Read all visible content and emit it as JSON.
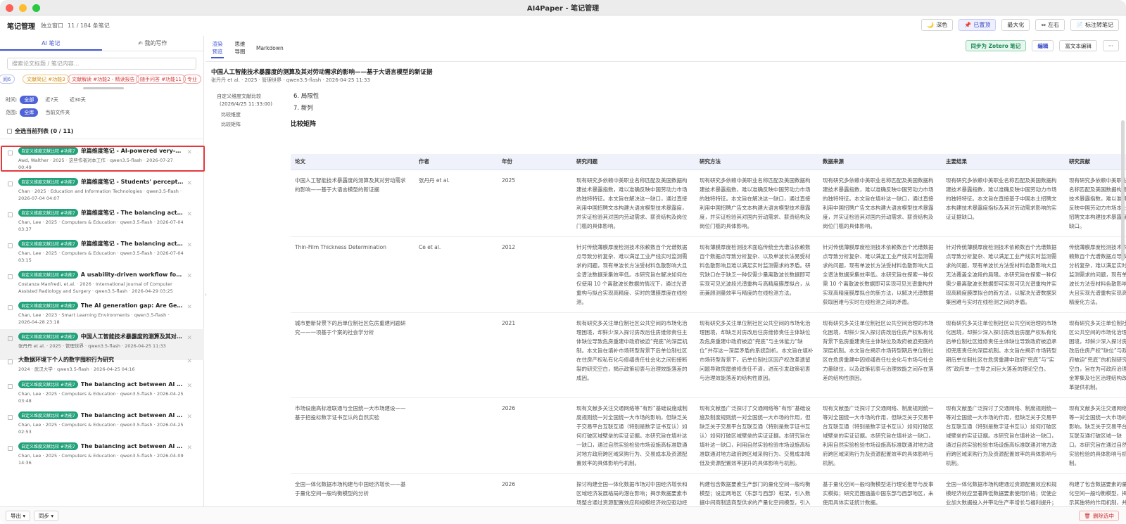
{
  "window": {
    "title": "AI4Paper - 笔记管理"
  },
  "header": {
    "title": "笔记管理",
    "subtitle": "独立窗口",
    "count": "11 / 184 条笔记",
    "buttons": {
      "dark": "深色",
      "pin": "已置顶",
      "maximize": "最大化",
      "lr": "左右",
      "annotate": "标注转笔记"
    }
  },
  "left": {
    "tabs": [
      "AI 笔记",
      "我的写作"
    ],
    "search_placeholder": "搜索论文标题 / 笔记内容...",
    "chips": [
      "阅6",
      "文献简记 #功能3",
      "文献解读 #功能2 - 精读报告",
      "随手问答 #功能11",
      "专业"
    ],
    "time_label": "时间:",
    "time_options": [
      "全部",
      "近7天",
      "近30天"
    ],
    "scope_label": "范围:",
    "scope_options": [
      "全库",
      "当前文件夹"
    ],
    "select_all": "全选当前列表 (0 / 11)",
    "items": [
      {
        "tag": "自定义维度文献比较 #功能7",
        "title": "单篇维度笔记 - AI-powered very-high-...",
        "meta": "Awd, Walther · 2025 · 这些作者对本工作 · qwen3.5-flash · 2026-07-27 00:49"
      },
      {
        "tag": "自定义维度文献比较 #功能7",
        "title": "单篇维度笔记 - Students' perceptions ...",
        "meta": "Chan · 2025 · Education and Information Technologies · qwen3.5-flash · 2026-07-04 04:07"
      },
      {
        "tag": "自定义维度文献比较 #功能7",
        "title": "单篇维度笔记 - The balancing act betw...",
        "meta": "Chan, Lee · 2025 · Computers & Education · qwen3.5-flash · 2026-07-04 03:37"
      },
      {
        "tag": "自定义维度文献比较 #功能7",
        "title": "单篇维度笔记 - The balancing act betw...",
        "meta": "Chan, Lee · 2025 · Computers & Education · qwen3.5-flash · 2026-07-04 03:15"
      },
      {
        "tag": "自定义维度文献比较 #功能7",
        "title": "A usability-driven workflow for virtual...",
        "meta": "Costanza Manfredi, et.al. · 2026 · International Journal of Computer Assisted Radiology and Surgery · qwen3.5-flash · 2026-04-29 03:25"
      },
      {
        "tag": "自定义维度文献比较 #功能7",
        "title": "The AI generation gap: Are Gen Z stu...",
        "meta": "Chan, Lee · 2023 · Smart Learning Environments · qwen3.5-flash · 2026-04-28 23:18"
      },
      {
        "tag": "自定义维度文献比较 #功能7",
        "title": "中国人工智能技术暴露度的测算及其对劳...",
        "meta": "张丹丹 et al. · 2025 · 管理世界 · qwen3.5-flash · 2026-04-25 11:33"
      },
      {
        "tag": "",
        "title": "大数据环境下个人的数字囤积行为研究",
        "meta": "2024 · 武汉大学 · qwen3.5-flash · 2026-04-25 04:16"
      },
      {
        "tag": "自定义维度文献比较 #功能7",
        "title": "The balancing act between AI and aut...",
        "meta": "Chan, Lee · 2025 · Computers & Education · qwen3.5-flash · 2026-04-25 03:48"
      },
      {
        "tag": "自定义维度文献比较 #功能7",
        "title": "The balancing act between AI and aut...",
        "meta": "Chan, Lee · 2025 · Computers & Education · qwen3.5-flash · 2026-04-25 02:53"
      },
      {
        "tag": "自定义维度文献比较 #功能7",
        "title": "The balancing act between AI and aut...",
        "meta": "Chan, Lee · 2025 · Computers & Education · qwen3.5-flash · 2026-04-09 14:36"
      }
    ]
  },
  "right": {
    "tabs": [
      "渲染预览",
      "思维导图",
      "Markdown"
    ],
    "actions": {
      "sync": "同步为 Zotero 笔记",
      "edit": "编辑",
      "rich_edit": "富文本编辑",
      "more": "···"
    },
    "note_title": "中国人工智能技术暴露度的测算及其对劳动需求的影响——基于大语言模型的新证据",
    "note_meta": "张丹丹 et al. · 2025 · 管理世界 · qwen3.5-flash · 2026-04-25 11:33",
    "toc": {
      "title": "自定义维度文献比较",
      "date": "(2026/4/25 11:33:00)",
      "items": [
        "比较维度",
        "比较矩阵"
      ]
    },
    "list": [
      "6. 局限性",
      "7. 新列"
    ],
    "section": "比较矩阵",
    "table": {
      "headers": [
        "论文",
        "作者",
        "年份",
        "研究问题",
        "研究方法",
        "数据来源",
        "主要结果",
        "研究贡献"
      ],
      "rows": [
        [
          "中国人工智能技术暴露度的测算及其对劳动需求的影响——基于大语言模型的新证据",
          "张丹丹 et al.",
          "2025",
          "现有研究多依赖中美职业名称匹配及美国数据构建技术暴露指数，难以准确反映中国劳动力市场的独特特征。本文旨在解决这一缺口，通过直接利用中国招聘文本构建大语言模型技术暴露度，并实证检验其对国内劳动需求、薪资结构及岗位门槛的具体影响。",
          "现有研究多依赖中美职业名称匹配及美国数据构建技术暴露指数，难以准确反映中国劳动力市场的独特特征。本文旨在解决这一缺口，通过直接利用中国招聘广告文本构建大语言模型技术暴露度，并实证检验其对国内劳动需求、薪资结构及岗位门槛的具体影响。",
          "现有研究多依赖中美职业名称匹配及美国数据构建技术暴露指数，难以准确反映中国劳动力市场的独特特征。本文旨在填补这一缺口，通过直接利用中国招聘广告文本构建大语言模型技术暴露度，并实证检验其对国内劳动需求、薪资结构及岗位门槛的具体影响。",
          "现有研究多依赖中美职业名称匹配及美国数据构建技术暴露指数，难以准确反映中国劳动力市场的独特特征。本文旨在直接基于中国本土招聘文本构建技术暴露度指标及其对劳动需求影响的实证证据缺口。",
          "现有研究多依赖中美职业名称匹配及美国数据构建技术暴露指数，难以准确反映中国劳动力市场本土招聘文本构建技术暴露度缺口。"
        ],
        [
          "Thin-Film Thickness Determination",
          "Ce et al.",
          "2012",
          "针对传统薄膜厚度检测技术依赖数百个光谱数据点导致分析复杂、难以满足工业产线实时监测需求的问题，现有单波长方法受材料色散影响大且全谱法数据采集效率低。本研究旨在解决如何在仅使用 10 个离散波长数据的情况下，通过光谱重构与拟合实现高精度、实时的薄膜厚度在线检测。",
          "现有薄膜厚度检测技术面临传统全光谱法依赖数百个数据点导致分析复杂、以及单波长法易受材料色散影响且难以满足实时监测需求的矛盾。研究缺口在于缺乏一种仅需少量离散波长数据即可实现可见光波段光谱重构与高精度膜厚拟合，从而兼顾测量效率与精度的在线检测方法。",
          "针对传统薄膜厚度检测技术依赖数百个光谱数据点导致分析复杂、难以满足工业产线实时监测需求的问题，现有单波长方法受材料色散影响大且全谱法数据采集效率低。本研究旨在探索一种仅需 10 个离散波长数据即可实现可见光谱重构并实现高精度膜厚拟合的新方法，以解决光谱数据获取困难与实时在线检测之间的矛盾。",
          "针对传统薄膜厚度检测技术依赖数百个光谱数据点导致分析复杂、难以满足工业产线实时监测需求的问题，现有单波长方法受材料色散影响大且无法覆盖全波段的局限。本研究旨在探索一种仅需少量离散波长数据即可实现可见光谱重构并实现高精度膜厚拟合的新方法，以解决光谱数据采集困难与实时在线检测之间的矛盾。",
          "传统薄膜厚度检测技术依赖数百个光谱数据点导致分析复杂，难以满足实时监测需求的问题，现有单波长方法受材料色散影响大且实现光谱重构实现高精度化方法。"
        ],
        [
          "城市更新背景下的后单位制社区危房重建问题研究——一项基于个案的社会学分析",
          "",
          "2021",
          "现有研究多关注单位制社区公共空间的市场化治理困境，却鲜少深入探讨房改后住房维修责任主体缺位导致危房重建中政府被迫“兜底”的深层机制。本文旨在填补市场转型背景下后单位制社区在住房产权私有化与修缮责任社会化之间衔接断裂的研究空白，揭示政策初衷与治理效能落差的成因。",
          "现有研究多关注单位制社区公共空间的市场化治理困境，却缺乏对房改后住房维修责任主体缺位及危房重建中政府被迫“兜底”与主体能力“缺位”并存这一深层矛盾的系统剖析。本文旨在填补市场转型背景下，后单位制社区因产权改革遗留问题导致房屋维修责任不清，进而引发政策初衷与治理效能落差的结构性原因。",
          "现有研究多关注单位制社区公共空间治理的市场化困境，却鲜少深入探讨房改后住房产权私有化背景下危房重建责任主体缺位及政府被迫兜底的深层机制。本文旨在揭示市场转型期后单位制社区在危房重建中因修缮责任社会化与市场与社会力量缺位，以及政策初衷与治理效能之间存在落差的结构性原因。",
          "现有研究多关注单位制社区公共空间治理的市场化困境，却鲜少深入探讨房改后房屋产权私有化后单位制社区维修责任主体缺位导致政府被迫承担兜底责任的深层机制。本文旨在揭示市场转型期后单位制社区在危房重建中政府“兜底”与“实然”政府单一主导之间巨大落差的理论空白。",
          "现有研究多关注单位制社区公共空间的市场化治理困境，却鲜少深入探讨房改后住房产权“缺位”与政府被迫“兜底”的机制研究空白，旨在为可政府治理金筹集及社区治理结构改革提供机制。"
        ],
        [
          "市场设施高标准联通与全国统一大市场建设——基于招投标数字证书互认的自然实验",
          "",
          "2026",
          "现有文献多关注交通网络等“有形”基础设施或制度规则统一对全国统一大市场的影响，但缺乏关于交易平台互联互通（特别是数字证书互认）如何打破区域壁垒的实证证据。本研究旨在填补这一缺口，通过自然实验检验市场设施高标准联通对地方政府跨区域采购行为、交易成本及资源配置效率的具体影响与机制。",
          "现有文献虽广泛探讨了交通网络等“有形”基础设施及制度规则统一对全国统一大市场的作用，但缺乏关于交易平台互联互通（特别是数字证书互认）如何打破区域壁垒的实证证据。本研究旨在填补这一缺口，利用自然实验检验市场设施高标准联通对地方政府跨区域采购行为、交易成本降低及资源配置效率提升的具体影响与机制。",
          "现有文献虽广泛探讨了交通网络、制度规则统一等对全国统一大市场的作用，但缺乏关于交易平台互联互通（特别是数字证书互认）如何打破区域壁垒的实证证据。本研究旨在填补这一缺口，利用自然实验检验市场设施高标准联通对地方政府跨区域采购行为及资源配置效率的具体影响与机制。",
          "现有文献虽广泛探讨了交通网络、制度规则统一等对全国统一大市场的作用，但缺乏关于交易平台互联互通（特别是数字证书互认）如何打破区域壁垒的实证证据。本研究旨在填补这一缺口，通过自然实验检验市场设施高标准联通对地方政府跨区域采购行为及资源配置效率的具体影响与机制。",
          "现有文献多关注交通网络等一对全国统一大市场的影响，缺乏关于交易平台互联互通打破区域一缺口。本研究旨在通过自然实验检验的具体影响与机制。"
        ],
        [
          "全国一体化数据市场构建与中国经济增长——基于量化空间一般均衡模型的分析",
          "",
          "2026",
          "探讨构建全国一体化数据市场对中国经济增长和区域经济发展格局的潜在影响；揭示数据要素市场整合通过资源配置效应和规模经济效应驱动经济增长的独特机制。",
          "构建包含数据要素生产部门的量化空间一般均衡模型；设定两地区（东部与西部）框架，引入数据中间商制造商型供求的产量化空间模型，引入数据中间商和新期数据清洗加工及非竞争性工作数据的跨区域流通机制；通过校准参数进行反事实模拟，分析市场一体化对资源配置、福利及区域差距的影响。",
          "基于量化空间一般均衡模型进行理论推导与反事实模拟；研究范围涵盖中国东部与西部地区，未使用具体实证统计数据。",
          "全国一体化数据市场构建通过资源配置效应和规模经济效应显著降低数据要素使用价格；促使企业加大数据投入并带动生产率增长与福利提升；深化东西部地区数字经济与实体经济的高水平分工协同；原始数据可替代性降低、随着数据中间商成本下降，效应数据要素使用。",
          "构建了包含数据要素的量化空间一般均衡模型，揭示其独特的作用机制，并为构建全国一体化数据市场提供理论依据和政策参考。"
        ]
      ]
    }
  },
  "footer": {
    "export": "导出",
    "sync": "同步",
    "delete": "删除选中"
  },
  "colors": {
    "accent": "#4357d1",
    "tag": "#22a27a",
    "highlight": "#e4393c"
  }
}
